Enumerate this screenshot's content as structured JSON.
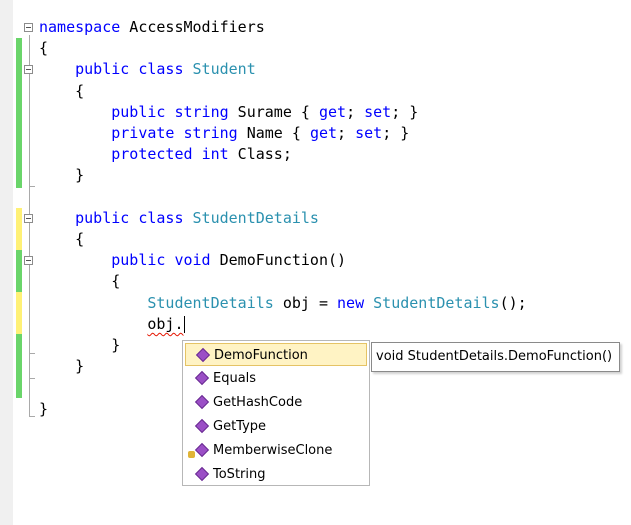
{
  "editor": {
    "lines": [
      [
        [
          "namespace",
          "kw"
        ],
        [
          " AccessModifiers",
          ""
        ]
      ],
      [
        [
          "{",
          ""
        ]
      ],
      [
        [
          "    ",
          ""
        ],
        [
          "public",
          "kw"
        ],
        [
          " ",
          ""
        ],
        [
          "class",
          "kw"
        ],
        [
          " ",
          ""
        ],
        [
          "Student",
          "tp"
        ]
      ],
      [
        [
          "    {",
          ""
        ]
      ],
      [
        [
          "        ",
          ""
        ],
        [
          "public",
          "kw"
        ],
        [
          " ",
          ""
        ],
        [
          "string",
          "kw"
        ],
        [
          " Surame { ",
          ""
        ],
        [
          "get",
          "kw"
        ],
        [
          "; ",
          ""
        ],
        [
          "set",
          "kw"
        ],
        [
          "; }",
          ""
        ]
      ],
      [
        [
          "        ",
          ""
        ],
        [
          "private",
          "kw"
        ],
        [
          " ",
          ""
        ],
        [
          "string",
          "kw"
        ],
        [
          " Name { ",
          ""
        ],
        [
          "get",
          "kw"
        ],
        [
          "; ",
          ""
        ],
        [
          "set",
          "kw"
        ],
        [
          "; }",
          ""
        ]
      ],
      [
        [
          "        ",
          ""
        ],
        [
          "protected",
          "kw"
        ],
        [
          " ",
          ""
        ],
        [
          "int",
          "kw"
        ],
        [
          " Class;",
          ""
        ]
      ],
      [
        [
          "    }",
          ""
        ]
      ],
      [
        [
          "",
          ""
        ]
      ],
      [
        [
          "    ",
          ""
        ],
        [
          "public",
          "kw"
        ],
        [
          " ",
          ""
        ],
        [
          "class",
          "kw"
        ],
        [
          " ",
          ""
        ],
        [
          "StudentDetails",
          "tp"
        ]
      ],
      [
        [
          "    {",
          ""
        ]
      ],
      [
        [
          "        ",
          ""
        ],
        [
          "public",
          "kw"
        ],
        [
          " ",
          ""
        ],
        [
          "void",
          "kw"
        ],
        [
          " DemoFunction()",
          ""
        ]
      ],
      [
        [
          "        {",
          ""
        ]
      ],
      [
        [
          "            ",
          ""
        ],
        [
          "StudentDetails",
          "tp"
        ],
        [
          " obj = ",
          ""
        ],
        [
          "new",
          "kw"
        ],
        [
          " ",
          ""
        ],
        [
          "StudentDetails",
          "tp"
        ],
        [
          "();",
          ""
        ]
      ],
      [
        [
          "            ",
          ""
        ],
        [
          "obj.",
          "squiggle"
        ]
      ],
      [
        [
          "        }",
          ""
        ]
      ],
      [
        [
          "    }",
          ""
        ]
      ],
      [
        [
          "",
          ""
        ]
      ],
      [
        [
          "}",
          ""
        ]
      ]
    ]
  },
  "completion": {
    "items": [
      {
        "label": "DemoFunction",
        "icon": "method-icon",
        "selected": true
      },
      {
        "label": "Equals",
        "icon": "method-icon",
        "selected": false
      },
      {
        "label": "GetHashCode",
        "icon": "method-icon",
        "selected": false
      },
      {
        "label": "GetType",
        "icon": "method-icon",
        "selected": false
      },
      {
        "label": "MemberwiseClone",
        "icon": "protected-method-icon",
        "selected": false
      },
      {
        "label": "ToString",
        "icon": "method-icon",
        "selected": false
      }
    ]
  },
  "tooltip": {
    "text": "void StudentDetails.DemoFunction()"
  },
  "colors": {
    "keyword": "#0000ff",
    "type": "#2b91af",
    "saved_change": "#6ad56a",
    "unsaved_change": "#fff176",
    "selection": "#fff3c4",
    "method_icon": "#9b4fc6"
  }
}
